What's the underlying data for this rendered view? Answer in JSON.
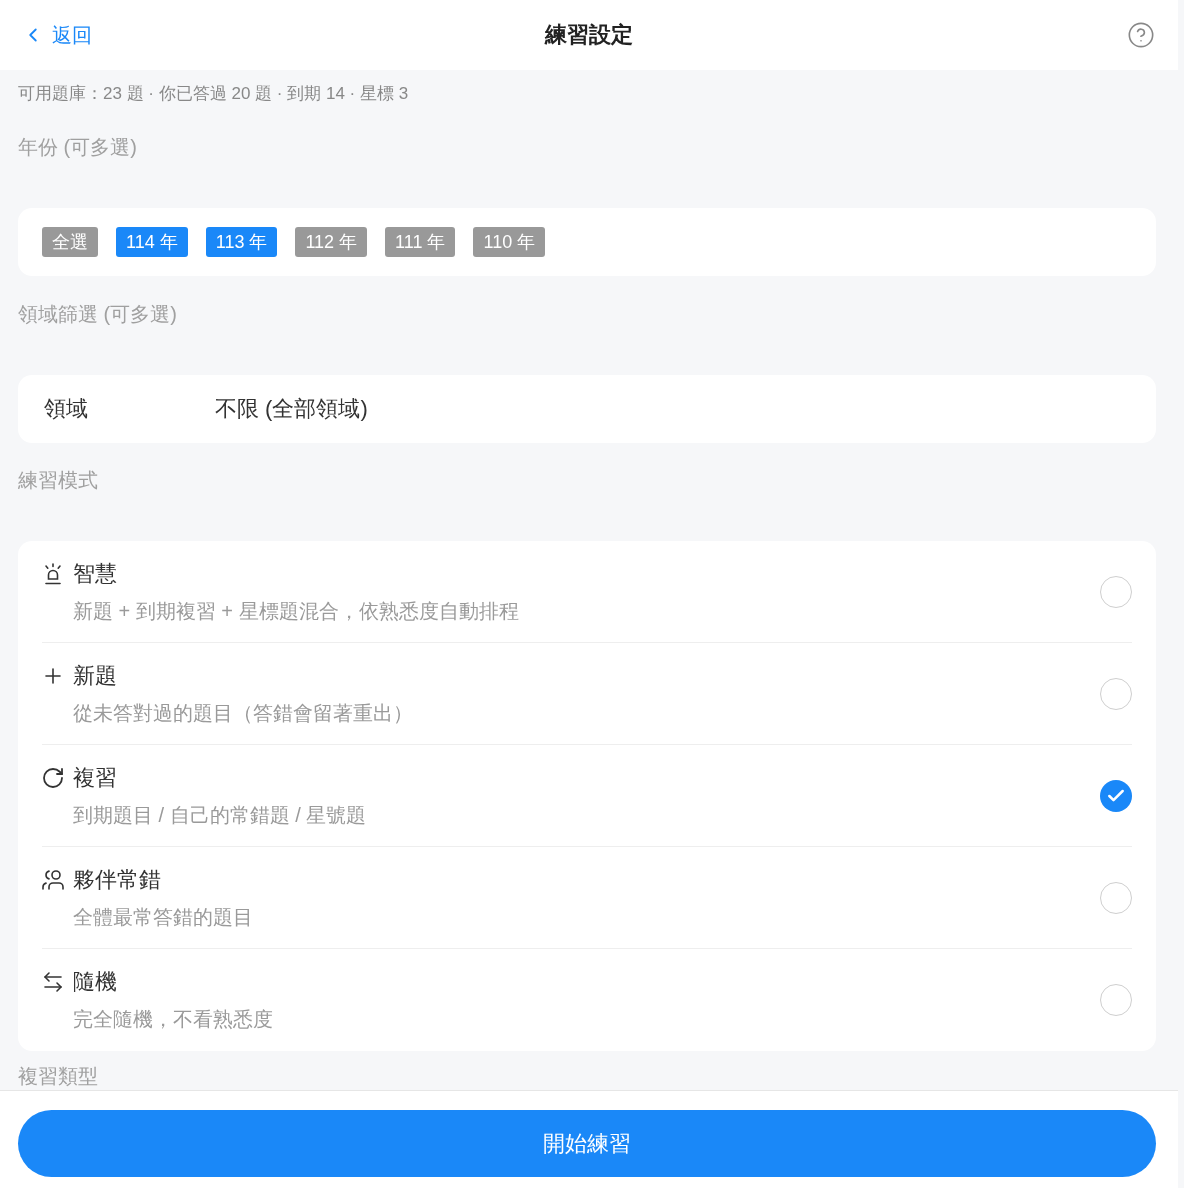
{
  "header": {
    "back_label": "返回",
    "title": "練習設定"
  },
  "summary": "可用題庫：23 題 · 你已答過 20 題 · 到期 14 · 星標 3",
  "year_section": {
    "label": "年份 (可多選)",
    "chips": [
      {
        "label": "全選",
        "selected": false
      },
      {
        "label": "114 年",
        "selected": true
      },
      {
        "label": "113 年",
        "selected": true
      },
      {
        "label": "112 年",
        "selected": false
      },
      {
        "label": "111 年",
        "selected": false
      },
      {
        "label": "110 年",
        "selected": false
      }
    ]
  },
  "domain_section": {
    "label": "領域篩選 (可多選)",
    "field": {
      "label": "領域",
      "value": "不限 (全部領域)"
    }
  },
  "mode_section": {
    "label": "練習模式",
    "modes": [
      {
        "kind": "smart",
        "title": "智慧",
        "description": "新題 + 到期複習 + 星標題混合，依熟悉度自動排程",
        "selected": false
      },
      {
        "kind": "new",
        "title": "新題",
        "description": "從未答對過的題目（答錯會留著重出）",
        "selected": false
      },
      {
        "kind": "review",
        "title": "複習",
        "description": "到期題目 / 自己的常錯題 / 星號題",
        "selected": true
      },
      {
        "kind": "peers",
        "title": "夥伴常錯",
        "description": "全體最常答錯的題目",
        "selected": false
      },
      {
        "kind": "random",
        "title": "隨機",
        "description": "完全隨機，不看熟悉度",
        "selected": false
      }
    ]
  },
  "next_section": {
    "label": "複習類型"
  },
  "start_button": "開始練習"
}
